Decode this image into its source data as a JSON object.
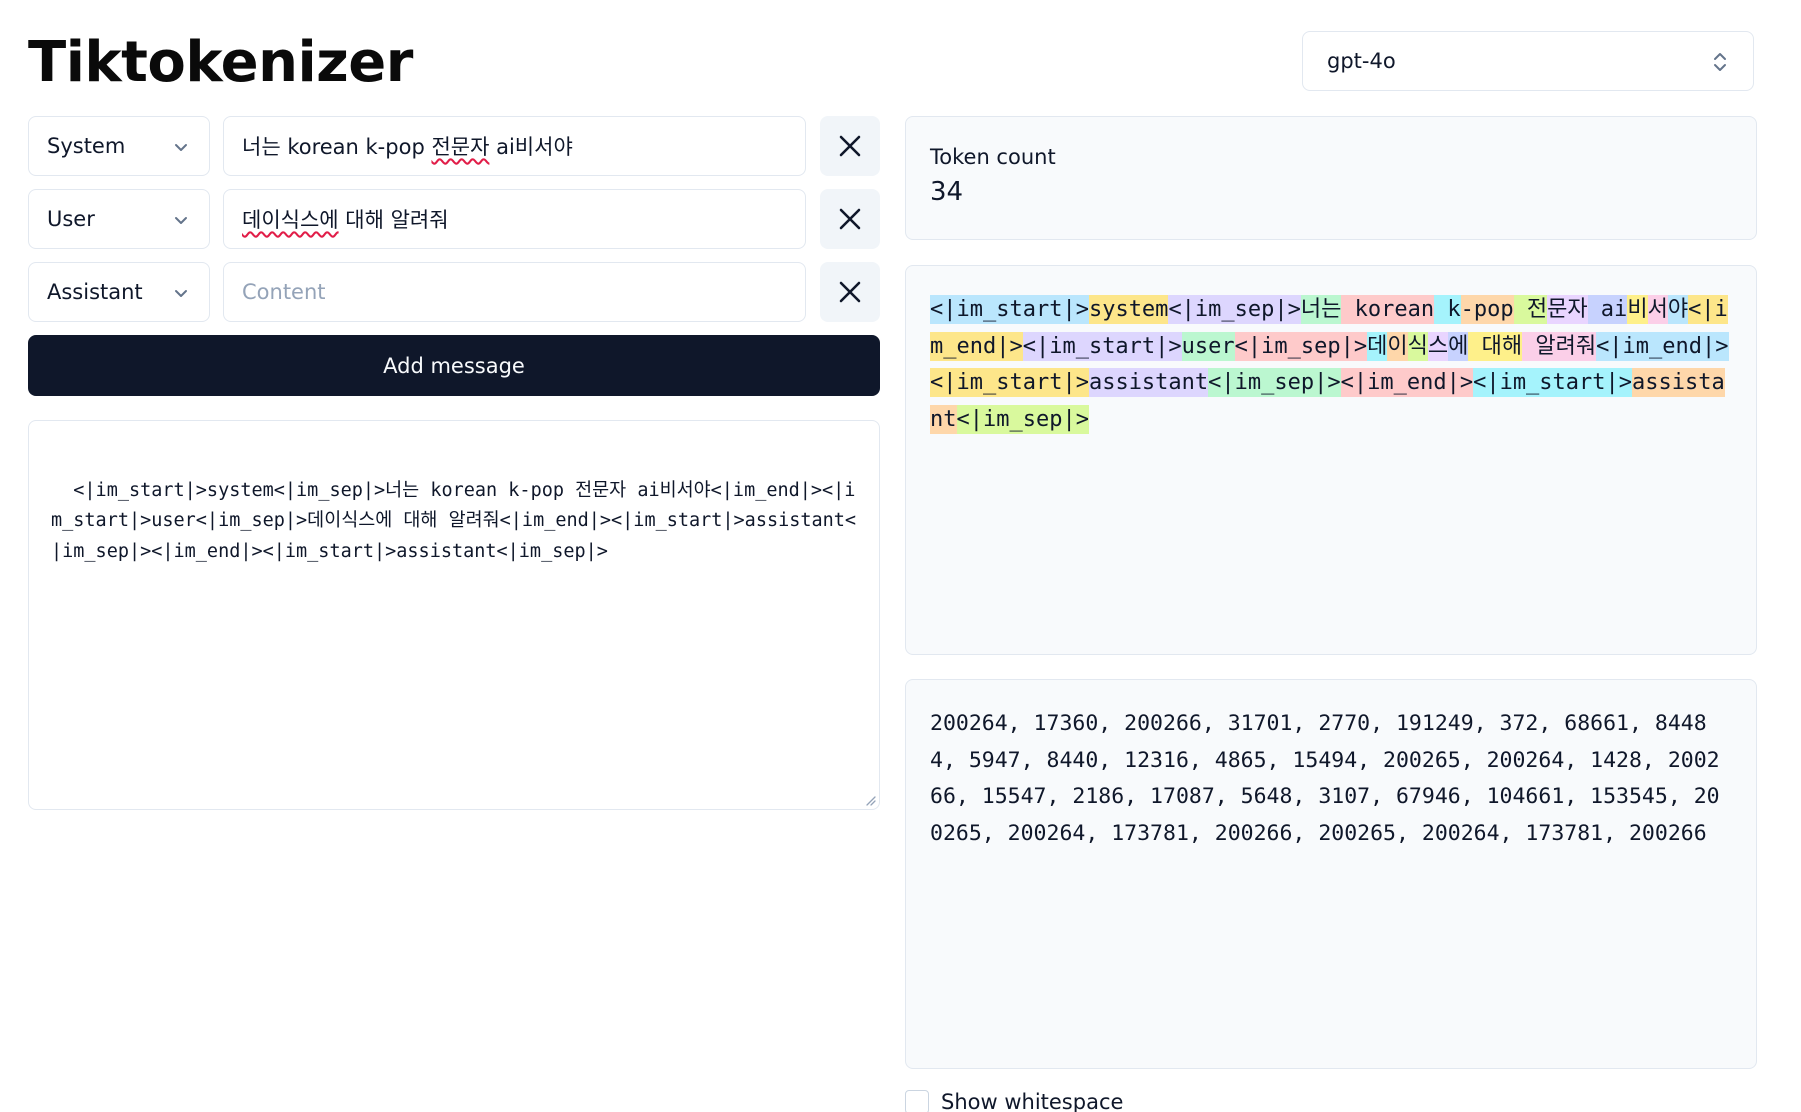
{
  "app": {
    "title": "Tiktokenizer"
  },
  "model": {
    "selected": "gpt-4o"
  },
  "messages": [
    {
      "role": "System",
      "content": "너는 korean k-pop 전문자 ai비서야",
      "content_pre": "너는 korean k-pop ",
      "content_squiggle": "전문자",
      "content_post": " ai비서야"
    },
    {
      "role": "User",
      "content": "데이식스에 대해 알려줘",
      "content_squiggle": "데이식스에",
      "content_post": " 대해 알려줘"
    },
    {
      "role": "Assistant",
      "content": "",
      "placeholder": "Content"
    }
  ],
  "add_message_label": "Add message",
  "raw_text": "<|im_start|>system<|im_sep|>너는 korean k-pop 전문자 ai비서야<|im_end|><|im_start|>user<|im_sep|>데이식스에 대해 알려줘<|im_end|><|im_start|>assistant<|im_sep|><|im_end|><|im_start|>assistant<|im_sep|>",
  "token_count": {
    "label": "Token count",
    "value": "34"
  },
  "token_colors": [
    "#bae6fd",
    "#fde68a",
    "#ddd6fe",
    "#bbf7d0",
    "#fecaca",
    "#a5f3fc",
    "#fed7aa",
    "#d9f99d",
    "#e9d5ff",
    "#c7d2fe",
    "#fef08a",
    "#fbcfe8"
  ],
  "tokens": [
    "<|im_start|>",
    "system",
    "<|im_sep|>",
    "너는",
    " korean",
    " k",
    "-pop",
    " 전",
    "문자",
    " ai",
    "비",
    "서",
    "야",
    "<|im_end|>",
    "<|im_start|>",
    "user",
    "<|im_sep|>",
    "데",
    "이",
    "식",
    "스",
    "에",
    " 대해",
    " 알려줘",
    "<|im_end|>",
    "<|im_start|>",
    "assistant",
    "<|im_sep|>",
    "<|im_end|>",
    "<|im_start|>",
    "assistant",
    "<|im_sep|>"
  ],
  "token_ids": "200264, 17360, 200266, 31701, 2770, 191249, 372, 68661, 84484, 5947, 8440, 12316, 4865, 15494, 200265, 200264, 1428, 200266, 15547, 2186, 17087, 5648, 3107, 67946, 104661, 153545, 200265, 200264, 173781, 200266, 200265, 200264, 173781, 200266",
  "show_whitespace_label": "Show whitespace"
}
